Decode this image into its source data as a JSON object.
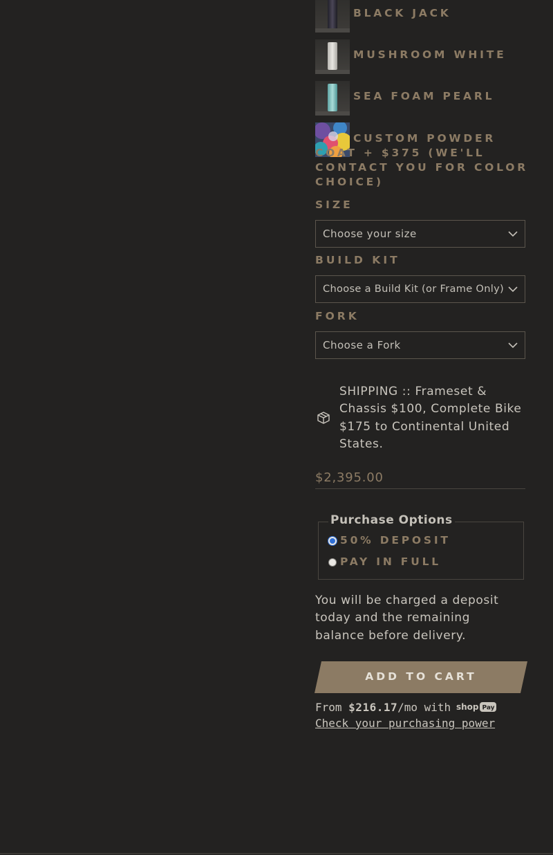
{
  "colors": {
    "background": "#232221",
    "accent": "#8c7b64",
    "text": "#c9c5bd",
    "button": "#8c7b64",
    "radio_checked": "#2f6fd6"
  },
  "color_options": [
    {
      "label": "Black Jack",
      "swatch": "black-tube-swatch"
    },
    {
      "label": "Mushroom White",
      "swatch": "white-tube-swatch"
    },
    {
      "label": "Sea Foam Pearl",
      "swatch": "seafoam-tube-swatch"
    },
    {
      "label": "Custom Powder Coat + $375 (We'll contact you for color choice)",
      "swatch": "powder-smoke-swatch"
    }
  ],
  "options": {
    "size": {
      "label": "Size",
      "value": "Choose your size"
    },
    "build_kit": {
      "label": "Build Kit",
      "value": "Choose a Build Kit (or Frame Only)"
    },
    "fork": {
      "label": "Fork",
      "value": "Choose a Fork"
    }
  },
  "shipping": {
    "icon": "package-box-icon",
    "text": "SHIPPING :: Frameset & Chassis $100, Complete Bike $175 to Continental United States."
  },
  "price": "$2,395.00",
  "purchase_options": {
    "legend": "Purchase Options",
    "items": [
      {
        "label": "50% Deposit",
        "checked": true
      },
      {
        "label": "Pay in full",
        "checked": false
      }
    ]
  },
  "deposit_note": "You will be charged a deposit today and the remaining balance before delivery.",
  "add_to_cart": "Add to cart",
  "installments": {
    "prefix": "From ",
    "amount": "$216.17",
    "suffix": "/mo with",
    "brand": "shop Pay",
    "link": "Check your purchasing power"
  }
}
